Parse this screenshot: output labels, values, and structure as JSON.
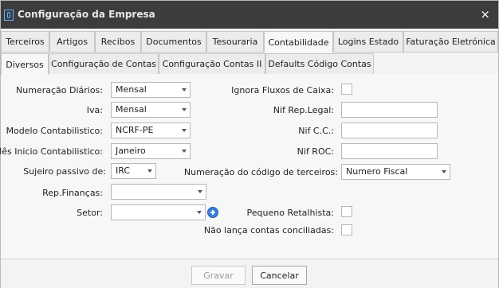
{
  "window": {
    "title": "Configuração da Empresa",
    "close": "×"
  },
  "tabs_top": [
    "Terceiros",
    "Artigos",
    "Recibos",
    "Documentos",
    "Tesouraria",
    "Contabilidade",
    "Logins Estado",
    "Faturação Eletrónica"
  ],
  "tabs_sub": [
    "Diversos",
    "Configuração de Contas",
    "Configuração Contas II",
    "Defaults Código Contas"
  ],
  "left": {
    "numeracao_diarios": {
      "label": "Numeração Diários:",
      "value": "Mensal"
    },
    "iva": {
      "label": "Iva:",
      "value": "Mensal"
    },
    "modelo": {
      "label": "Modelo Contabilistico:",
      "value": "NCRF-PE"
    },
    "mes_inicio": {
      "label": "Mês Inicio Contabilistico:",
      "value": "Janeiro"
    },
    "sujeito_passivo": {
      "label": "Sujeiro passivo de:",
      "value": "IRC"
    },
    "rep_financas": {
      "label": "Rep.Finanças:",
      "value": ""
    },
    "setor": {
      "label": "Setor:",
      "value": ""
    }
  },
  "right": {
    "ignora_fluxos": {
      "label": "Ignora Fluxos de Caixa:"
    },
    "nif_rep_legal": {
      "label": "Nif Rep.Legal:",
      "value": ""
    },
    "nif_cc": {
      "label": "Nif C.C.:",
      "value": ""
    },
    "nif_roc": {
      "label": "Nif ROC:",
      "value": ""
    },
    "numeracao_terceiros": {
      "label": "Numeração do código de terceiros:",
      "value": "Numero Fiscal"
    },
    "pequeno_retalhista": {
      "label": "Pequeno Retalhista:"
    },
    "nao_lanca": {
      "label": "Não lança contas conciliadas:"
    }
  },
  "buttons": {
    "gravar": "Gravar",
    "cancelar": "Cancelar"
  }
}
